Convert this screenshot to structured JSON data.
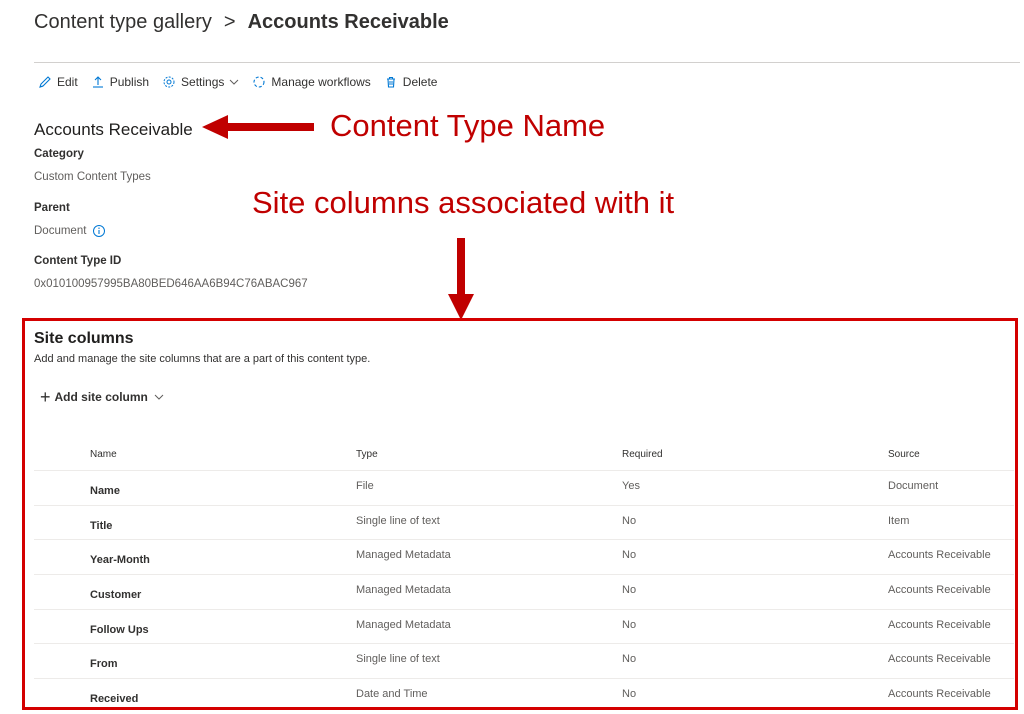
{
  "breadcrumb": {
    "root": "Content type gallery",
    "current": "Accounts Receivable"
  },
  "toolbar": {
    "edit": "Edit",
    "publish": "Publish",
    "settings": "Settings",
    "manage_workflows": "Manage workflows",
    "delete": "Delete"
  },
  "content_type": {
    "name": "Accounts Receivable",
    "category_label": "Category",
    "category_value": "Custom Content Types",
    "parent_label": "Parent",
    "parent_value": "Document",
    "id_label": "Content Type ID",
    "id_value": "0x010100957995BA80BED646AA6B94C76ABAC967"
  },
  "annotations": {
    "name_callout": "Content Type Name",
    "columns_callout": "Site columns associated with it"
  },
  "site_columns": {
    "title": "Site columns",
    "description": "Add and manage the site columns that are a part of this content type.",
    "add_label": "Add site column",
    "headers": {
      "name": "Name",
      "type": "Type",
      "required": "Required",
      "source": "Source"
    },
    "rows": [
      {
        "name": "Name",
        "type": "File",
        "required": "Yes",
        "source": "Document"
      },
      {
        "name": "Title",
        "type": "Single line of text",
        "required": "No",
        "source": "Item"
      },
      {
        "name": "Year-Month",
        "type": "Managed Metadata",
        "required": "No",
        "source": "Accounts Receivable"
      },
      {
        "name": "Customer",
        "type": "Managed Metadata",
        "required": "No",
        "source": "Accounts Receivable"
      },
      {
        "name": "Follow Ups",
        "type": "Managed Metadata",
        "required": "No",
        "source": "Accounts Receivable"
      },
      {
        "name": "From",
        "type": "Single line of text",
        "required": "No",
        "source": "Accounts Receivable"
      },
      {
        "name": "Received",
        "type": "Date and Time",
        "required": "No",
        "source": "Accounts Receivable"
      }
    ]
  },
  "colors": {
    "annotation_red": "#c00000",
    "box_red": "#d40000",
    "icon_blue": "#0078d4"
  }
}
